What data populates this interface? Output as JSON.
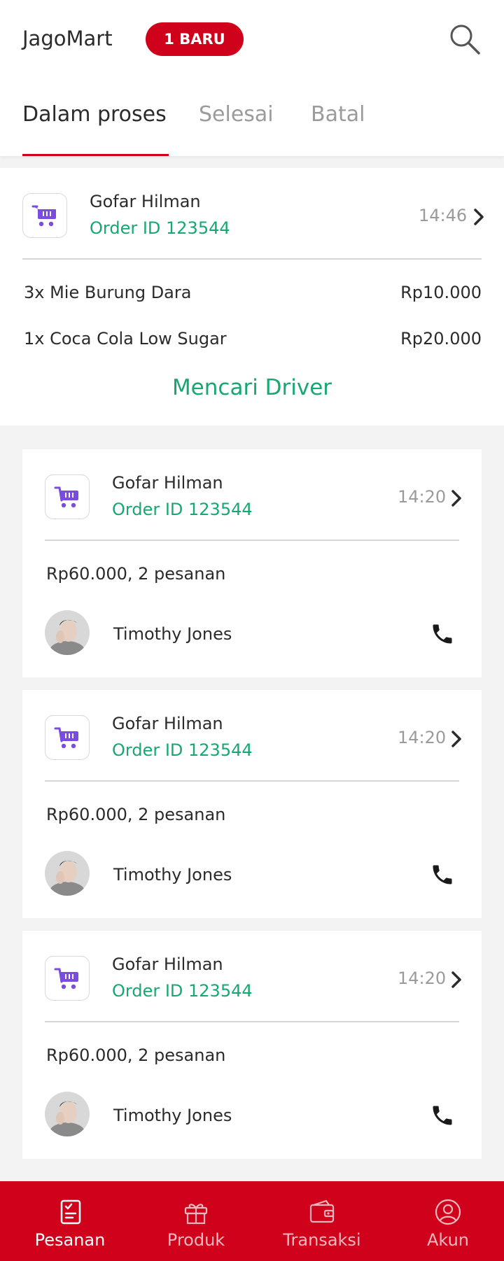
{
  "header": {
    "app_title": "JagoMart",
    "badge": "1 BARU",
    "search_icon": "search-icon"
  },
  "tabs": [
    {
      "label": "Dalam proses",
      "active": true
    },
    {
      "label": "Selesai",
      "active": false
    },
    {
      "label": "Batal",
      "active": false
    }
  ],
  "active_order": {
    "customer": "Gofar Hilman",
    "order_id": "Order ID 123544",
    "time": "14:46",
    "items": [
      {
        "name": "3x Mie Burung Dara",
        "price": "Rp10.000"
      },
      {
        "name": "1x Coca Cola Low Sugar",
        "price": "Rp20.000"
      }
    ],
    "status": "Mencari Driver"
  },
  "orders": [
    {
      "customer": "Gofar Hilman",
      "order_id": "Order ID 123544",
      "time": "14:20",
      "summary": "Rp60.000, 2 pesanan",
      "driver": "Timothy Jones"
    },
    {
      "customer": "Gofar Hilman",
      "order_id": "Order ID 123544",
      "time": "14:20",
      "summary": "Rp60.000, 2 pesanan",
      "driver": "Timothy Jones"
    },
    {
      "customer": "Gofar Hilman",
      "order_id": "Order ID 123544",
      "time": "14:20",
      "summary": "Rp60.000, 2 pesanan",
      "driver": "Timothy Jones"
    }
  ],
  "bottom_nav": [
    {
      "label": "Pesanan",
      "icon": "orders-icon",
      "active": true
    },
    {
      "label": "Produk",
      "icon": "gift-icon",
      "active": false
    },
    {
      "label": "Transaksi",
      "icon": "wallet-icon",
      "active": false
    },
    {
      "label": "Akun",
      "icon": "account-icon",
      "active": false
    }
  ],
  "colors": {
    "brand_red": "#d0021b",
    "accent_green": "#16a870",
    "cart_purple": "#7b4ce0"
  }
}
